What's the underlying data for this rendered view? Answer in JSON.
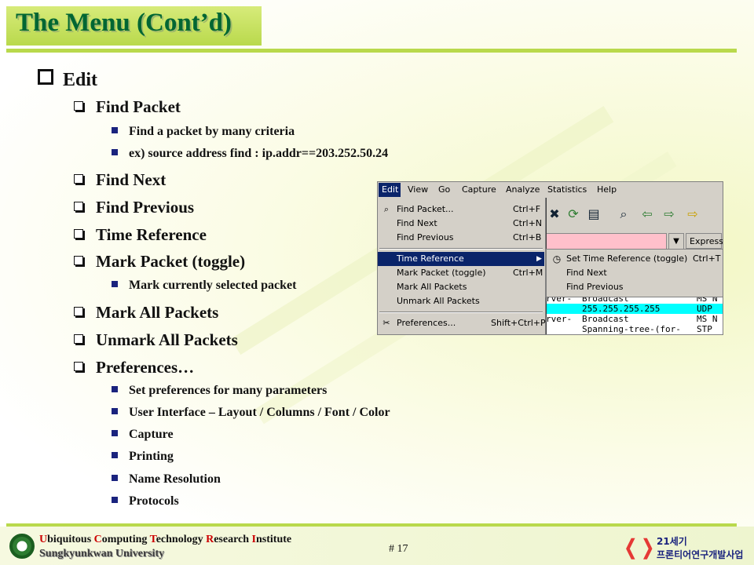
{
  "title": "The Menu (Cont’d)",
  "outline": {
    "edit": "Edit",
    "find_packet": "Find Packet",
    "find_packet_sub": [
      "Find a packet by many criteria",
      "ex) source address find : ip.addr==203.252.50.24"
    ],
    "find_next": "Find Next",
    "find_previous": "Find Previous",
    "time_reference": "Time Reference",
    "mark_packet": "Mark Packet (toggle)",
    "mark_packet_sub": [
      "Mark currently selected packet"
    ],
    "mark_all": "Mark All Packets",
    "unmark_all": "Unmark All Packets",
    "preferences": "Preferences…",
    "preferences_sub": [
      "Set preferences for many parameters",
      "User Interface – Layout / Columns / Font / Color",
      "Capture",
      "Printing",
      "Name Resolution",
      "Protocols"
    ]
  },
  "screenshot": {
    "menubar": [
      "Edit",
      "View",
      "Go",
      "Capture",
      "Analyze",
      "Statistics",
      "Help"
    ],
    "edit_menu": [
      {
        "label": "Find Packet...",
        "shortcut": "Ctrl+F",
        "icon": "find-icon"
      },
      {
        "label": "Find Next",
        "shortcut": "Ctrl+N"
      },
      {
        "label": "Find Previous",
        "shortcut": "Ctrl+B"
      },
      {
        "label": "Time Reference",
        "shortcut": ""
      },
      {
        "label": "Mark Packet (toggle)",
        "shortcut": "Ctrl+M"
      },
      {
        "label": "Mark All Packets",
        "shortcut": ""
      },
      {
        "label": "Unmark All Packets",
        "shortcut": ""
      },
      {
        "label": "Preferences...",
        "shortcut": "Shift+Ctrl+P",
        "icon": "preferences-icon"
      }
    ],
    "submenu": [
      {
        "label": "Set Time Reference (toggle)",
        "shortcut": "Ctrl+T",
        "icon": "clock-icon"
      },
      {
        "label": "Find Next",
        "shortcut": ""
      },
      {
        "label": "Find Previous",
        "shortcut": ""
      }
    ],
    "filter_button": "Express",
    "packets": [
      {
        "c1": "rver-",
        "c2": "Broadcast",
        "c3": "MS N"
      },
      {
        "c1": "",
        "c2": "255.255.255.255",
        "c3": "UDP"
      },
      {
        "c1": "rver-",
        "c2": "Broadcast",
        "c3": "MS N"
      },
      {
        "c1": "",
        "c2": "Spanning-tree-(for-",
        "c3": "STP"
      }
    ]
  },
  "footer": {
    "line1_parts": [
      "U",
      "biquitous ",
      "C",
      "omputing ",
      "T",
      "echnology ",
      "R",
      "esearch ",
      "I",
      "nstitute"
    ],
    "line2": "Sungkyunkwan University",
    "page": "# 17",
    "logo_line1": "21세기",
    "logo_line2": "프론티어연구개발사업"
  }
}
